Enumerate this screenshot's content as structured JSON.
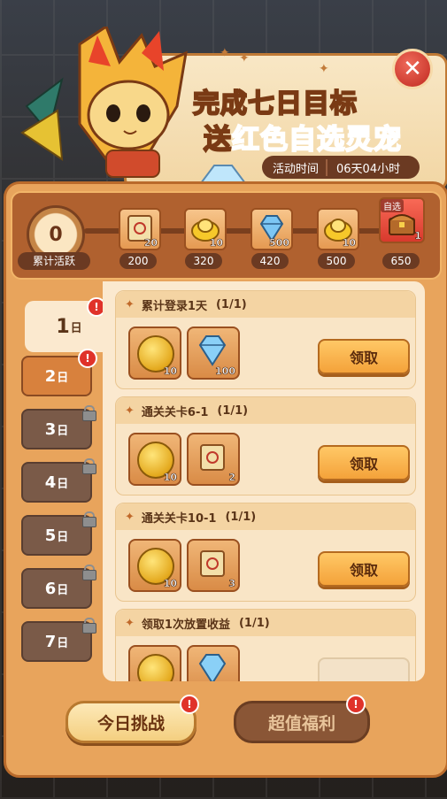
{
  "header": {
    "title_line1": "完成七日目标",
    "title_line2_prefix": "送",
    "title_line2_highlight": "红色自选灵宠",
    "time_label": "活动时间",
    "time_value": "06天04小时",
    "close_icon": "close-icon"
  },
  "progress": {
    "active_value": "0",
    "active_label": "累计活跃",
    "milestones": [
      {
        "icon": "scroll-icon",
        "count": "20",
        "points": "200"
      },
      {
        "icon": "gold-ingot-icon",
        "count": "10",
        "points": "320"
      },
      {
        "icon": "diamond-icon",
        "count": "500",
        "points": "420"
      },
      {
        "icon": "gold-ingot-icon",
        "count": "10",
        "points": "500"
      },
      {
        "icon": "treasure-chest-icon",
        "count": "1",
        "points": "650",
        "tag": "自选"
      }
    ]
  },
  "days": [
    {
      "num": "1",
      "unit": "日",
      "state": "selected",
      "badge": "!"
    },
    {
      "num": "2",
      "unit": "日",
      "state": "open",
      "badge": "!"
    },
    {
      "num": "3",
      "unit": "日",
      "state": "locked"
    },
    {
      "num": "4",
      "unit": "日",
      "state": "locked"
    },
    {
      "num": "5",
      "unit": "日",
      "state": "locked"
    },
    {
      "num": "6",
      "unit": "日",
      "state": "locked"
    },
    {
      "num": "7",
      "unit": "日",
      "state": "locked"
    }
  ],
  "tasks": [
    {
      "title": "累计登录1天",
      "progress": "(1/1)",
      "claim": "领取",
      "rewards": [
        {
          "icon": "coin-icon",
          "count": "10"
        },
        {
          "icon": "diamond-icon",
          "count": "100"
        }
      ]
    },
    {
      "title": "通关关卡6-1",
      "progress": "(1/1)",
      "claim": "领取",
      "rewards": [
        {
          "icon": "coin-icon",
          "count": "10"
        },
        {
          "icon": "scroll-icon",
          "count": "2"
        }
      ]
    },
    {
      "title": "通关关卡10-1",
      "progress": "(1/1)",
      "claim": "领取",
      "rewards": [
        {
          "icon": "coin-icon",
          "count": "10"
        },
        {
          "icon": "scroll-icon",
          "count": "3"
        }
      ]
    },
    {
      "title": "领取1次放置收益",
      "progress": "(1/1)",
      "claim": "",
      "rewards": [
        {
          "icon": "coin-icon",
          "count": ""
        },
        {
          "icon": "diamond-icon",
          "count": ""
        }
      ]
    }
  ],
  "bottom": {
    "today_label": "今日挑战",
    "welfare_label": "超值福利"
  },
  "colors": {
    "frame": "#e8a45c",
    "accent_red": "#e2312c",
    "dark_brown": "#6b3a22"
  }
}
